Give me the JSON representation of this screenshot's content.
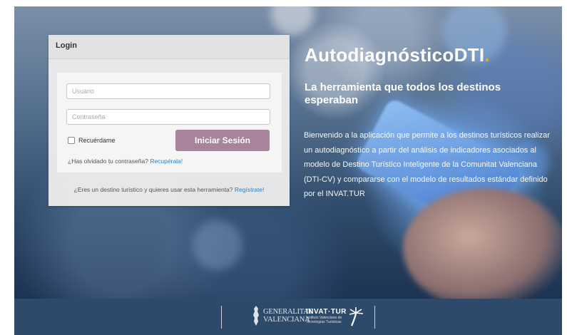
{
  "hero": {
    "title_main": "AutodiagnósticoDTI",
    "title_dot": ".",
    "subtitle": "La herramienta que todos los destinos esperaban",
    "description": "Bienvenido a la aplicación que permite a los destinos turísticos realizar un autodiagnóstico a partir del análisis de indicadores asociados al modelo de Destino Turístico Inteligente de la Comunitat Valenciana (DTI-CV) y compararse con el modelo de resultados estándar definido por el INVAT.TUR"
  },
  "login": {
    "header": "Login",
    "username_placeholder": "Usuario",
    "password_placeholder": "Contraseña",
    "remember_label": "Recuérdame",
    "submit_label": "Iniciar Sesión",
    "forgot_text": "¿Has olvidado tu contraseña?",
    "forgot_link": "Recupérala!",
    "register_text": "¿Eres un destino turístico y quieres usar esta herramienta?",
    "register_link": "Regístrate!"
  },
  "footer": {
    "generalitat_line1": "GENERALITAT",
    "generalitat_line2": "VALENCIANA",
    "invat_title": "INVAT·TUR",
    "invat_line1": "Instituto Valenciano de",
    "invat_line2": "Tecnologías Turísticas",
    "icons": [
      "generalitat-crest-icon",
      "palm-tree-icon"
    ]
  },
  "colors": {
    "accent": "#f0a31e",
    "button": "#a8849c",
    "link": "#2f7ec1",
    "footer_bg": "#2e4a6b"
  }
}
